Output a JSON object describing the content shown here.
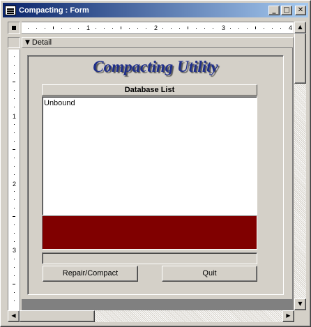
{
  "window": {
    "title": "Compacting : Form"
  },
  "title_buttons": {
    "minimize": "_",
    "maximize": "□",
    "close": "✕"
  },
  "ruler": {
    "horizontal_numbers": [
      "1",
      "2",
      "3",
      "4"
    ],
    "vertical_numbers": [
      "1",
      "2",
      "3"
    ]
  },
  "section": {
    "label": "Detail"
  },
  "form": {
    "title": "Compacting Utility",
    "list_header": "Database List",
    "list_value": "Unbound",
    "progress": 0,
    "buttons": {
      "repair": "Repair/Compact",
      "quit": "Quit"
    }
  },
  "colors": {
    "title_gradient_start": "#0a246a",
    "title_gradient_end": "#a6caf0",
    "form_title": "#1f2f8a",
    "status_box": "#800000",
    "face": "#d4d0c8"
  },
  "icons": {
    "window": "form-icon",
    "section": "down-arrow-icon"
  }
}
